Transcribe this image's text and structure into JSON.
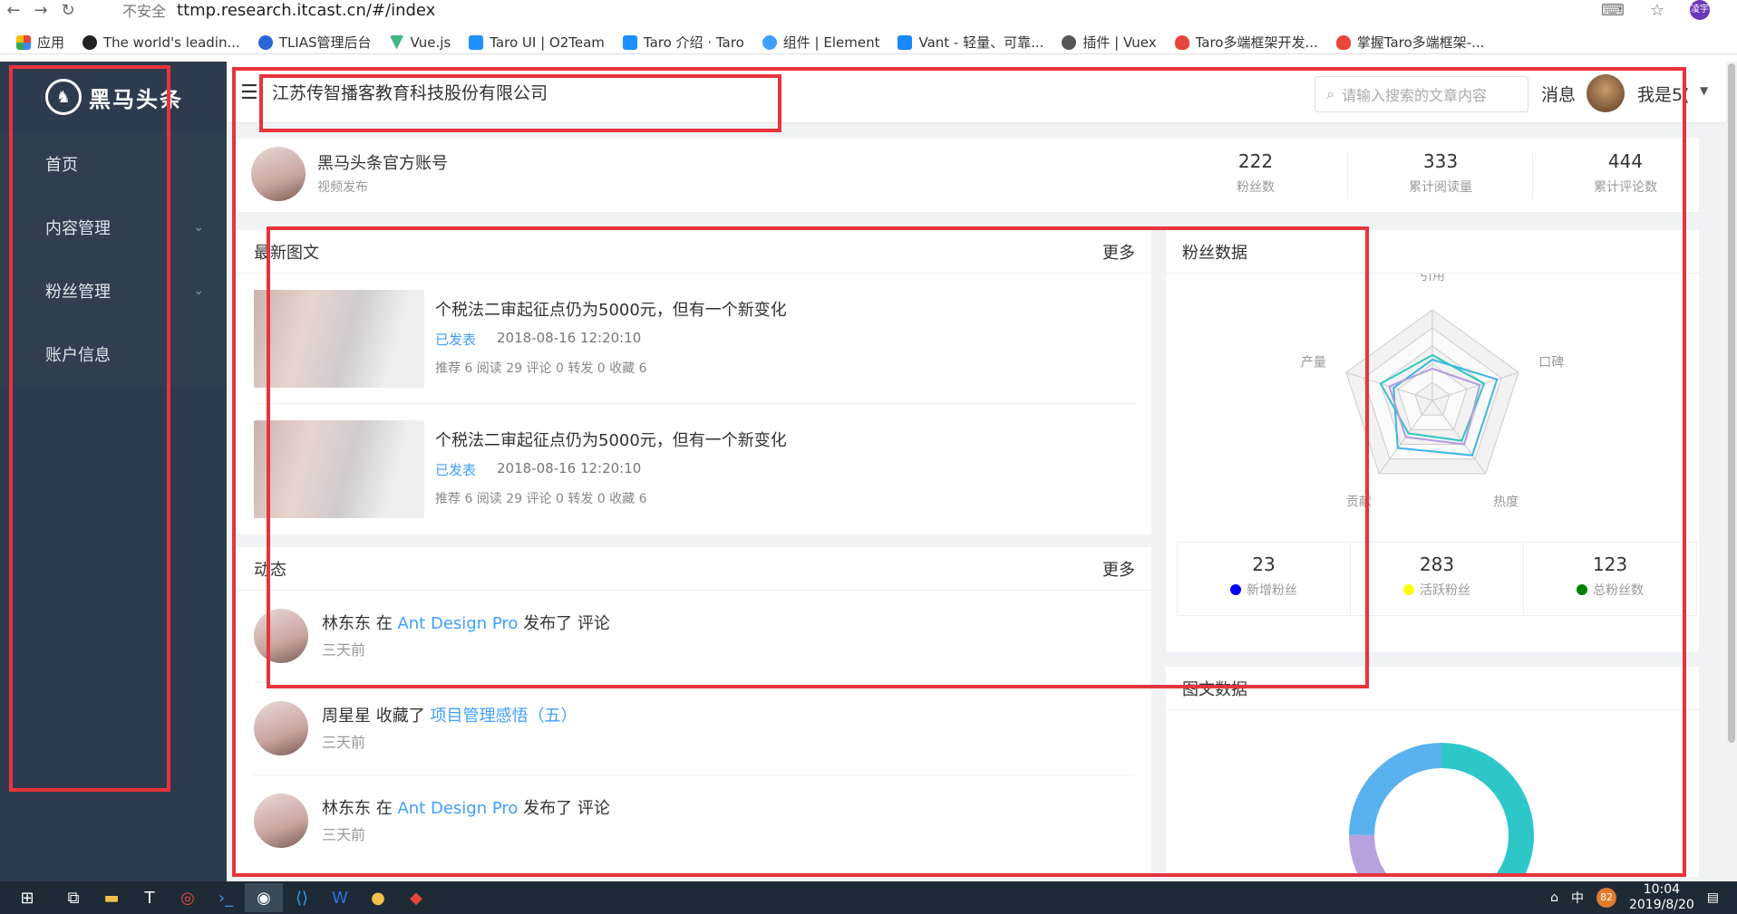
{
  "browser": {
    "security": "不安全",
    "url": "ttmp.research.itcast.cn/#/index",
    "bookmarks": [
      "应用",
      "The world's leadin...",
      "TLIAS管理后台",
      "Vue.js",
      "Taro UI | O2Team",
      "Taro 介绍 · Taro",
      "组件 | Element",
      "Vant - 轻量、可靠...",
      "插件 | Vuex",
      "Taro多端框架开发...",
      "掌握Taro多端框架-..."
    ],
    "profile_label": "凌宇"
  },
  "sidebar": {
    "logo_text": "黑马头条",
    "items": [
      {
        "label": "首页"
      },
      {
        "label": "内容管理"
      },
      {
        "label": "粉丝管理"
      },
      {
        "label": "账户信息"
      }
    ]
  },
  "header": {
    "company": "江苏传智播客教育科技股份有限公司",
    "search_placeholder": "请输入搜索的文章内容",
    "message": "消息",
    "user": "我是5("
  },
  "account": {
    "name": "黑马头条官方账号",
    "sub": "视频发布",
    "stats": [
      {
        "num": "222",
        "label": "粉丝数"
      },
      {
        "num": "333",
        "label": "累计阅读量"
      },
      {
        "num": "444",
        "label": "累计评论数"
      }
    ]
  },
  "news": {
    "title": "最新图文",
    "more": "更多",
    "articles": [
      {
        "title": "个税法二审起征点仍为5000元，但有一个新变化",
        "status": "已发表",
        "date": "2018-08-16 12:20:10",
        "meta": "推荐 6 阅读 29 评论 0 转发 0 收藏 6"
      },
      {
        "title": "个税法二审起征点仍为5000元，但有一个新变化",
        "status": "已发表",
        "date": "2018-08-16 12:20:10",
        "meta": "推荐 6 阅读 29 评论 0 转发 0 收藏 6"
      }
    ]
  },
  "activity": {
    "title": "动态",
    "more": "更多",
    "items": [
      {
        "user": "林东东",
        "verb1": " 在 ",
        "link": "Ant Design Pro",
        "verb2": " 发布了 评论",
        "time": "三天前"
      },
      {
        "user": "周星星",
        "verb1": " 收藏了 ",
        "link": "项目管理感悟（五）",
        "verb2": "",
        "time": "三天前"
      },
      {
        "user": "林东东",
        "verb1": " 在 ",
        "link": "Ant Design Pro",
        "verb2": " 发布了 评论",
        "time": "三天前"
      }
    ]
  },
  "fans": {
    "title": "粉丝数据",
    "radar_labels": [
      "引用",
      "口碑",
      "热度",
      "贡献",
      "产量"
    ],
    "stats": [
      {
        "num": "23",
        "label": "新增粉丝",
        "color": "#0000ff"
      },
      {
        "num": "283",
        "label": "活跃粉丝",
        "color": "#ffff00"
      },
      {
        "num": "123",
        "label": "总粉丝数",
        "color": "#008000"
      }
    ]
  },
  "article_data": {
    "title": "图文数据"
  },
  "chart_data": [
    {
      "type": "radar",
      "categories": [
        "引用",
        "口碑",
        "热度",
        "贡献",
        "产量"
      ],
      "series": [
        {
          "values": [
            0.45,
            0.75,
            0.75,
            0.65,
            0.45
          ],
          "color": "#3bb4e6"
        },
        {
          "values": [
            0.5,
            0.6,
            0.55,
            0.45,
            0.6
          ],
          "color": "#2fc7c1"
        },
        {
          "values": [
            0.35,
            0.55,
            0.6,
            0.5,
            0.5
          ],
          "color": "#b39ddb"
        }
      ]
    },
    {
      "type": "pie",
      "values": [
        45,
        30,
        25
      ],
      "colors": [
        "#2ec7c9",
        "#b6a2de",
        "#5ab1ef"
      ]
    }
  ],
  "taskbar": {
    "time": "10:04",
    "date": "2019/8/20",
    "badge": "82",
    "ime": "中"
  }
}
